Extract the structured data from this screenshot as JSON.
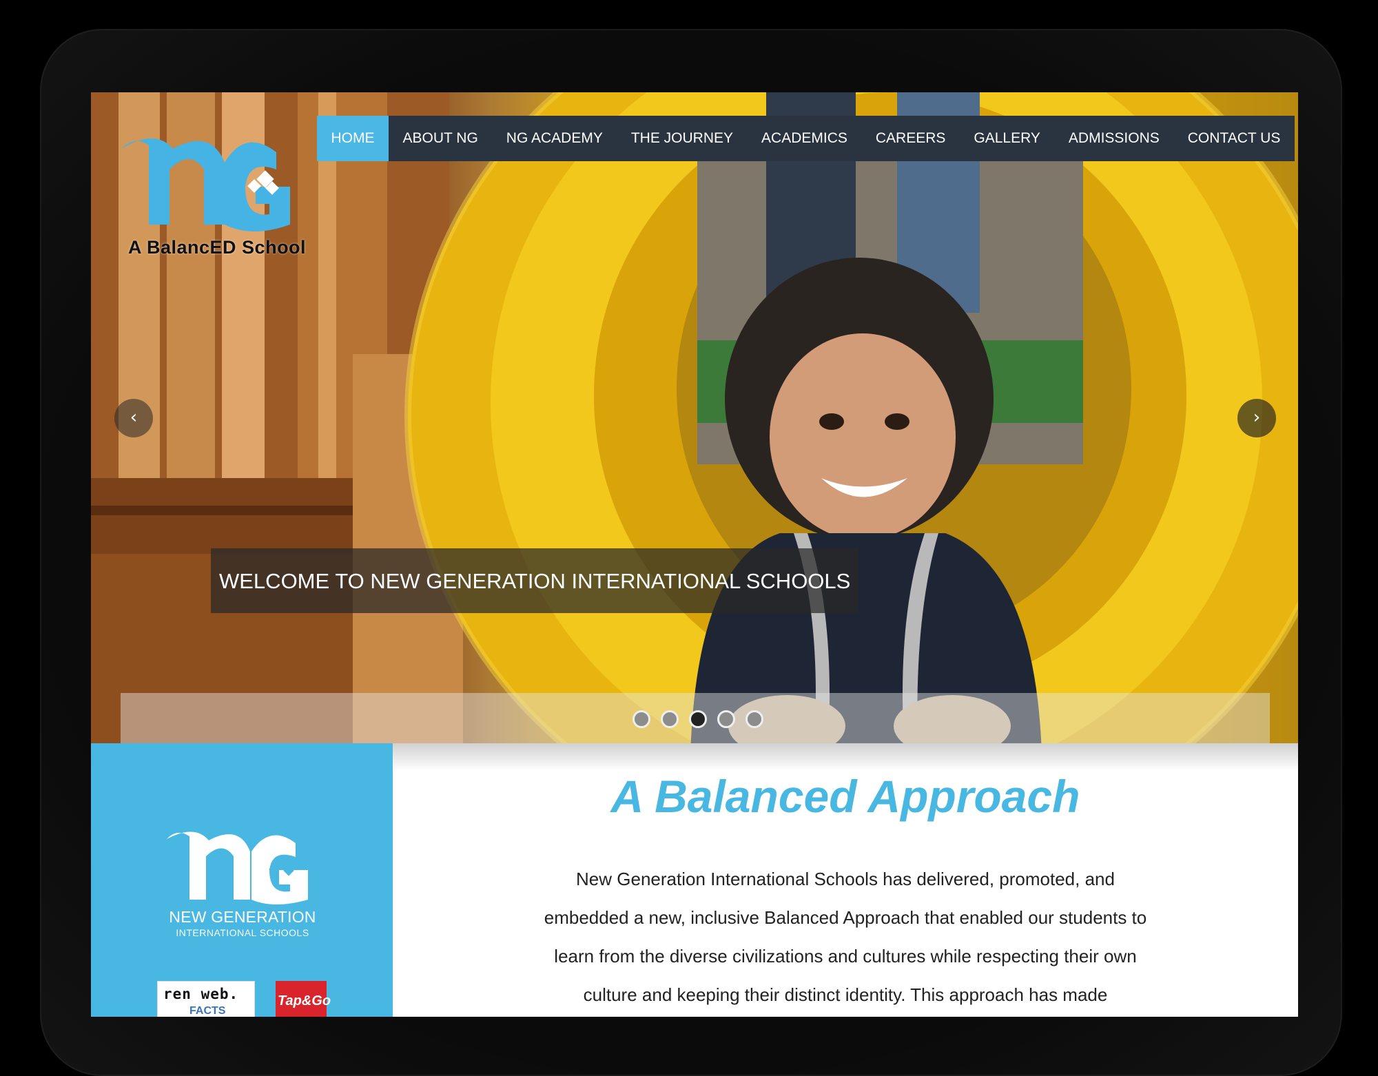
{
  "brand": {
    "logo_letters": "nG",
    "tagline": "A BalancED School"
  },
  "nav": {
    "items": [
      {
        "label": "HOME",
        "active": true
      },
      {
        "label": "ABOUT NG",
        "active": false
      },
      {
        "label": "NG ACADEMY",
        "active": false
      },
      {
        "label": "THE JOURNEY",
        "active": false
      },
      {
        "label": "ACADEMICS",
        "active": false
      },
      {
        "label": "CAREERS",
        "active": false
      },
      {
        "label": "GALLERY",
        "active": false
      },
      {
        "label": "ADMISSIONS",
        "active": false
      },
      {
        "label": "CONTACT US",
        "active": false
      }
    ]
  },
  "slider": {
    "prev_label": "‹",
    "next_label": "›",
    "caption": "WELCOME TO NEW GENERATION INTERNATIONAL SCHOOLS",
    "slide_count": 5,
    "active_slide": 3
  },
  "side_panel": {
    "logo_letters": "nG",
    "school_name_line1": "NEW GENERATION",
    "school_name_line2": "INTERNATIONAL SCHOOLS",
    "badges": [
      {
        "name": "renweb",
        "text": "ren web.",
        "sub": "FACTS"
      },
      {
        "name": "tap-and-go",
        "text": "Tap&Go"
      }
    ]
  },
  "content": {
    "title": "A Balanced Approach",
    "body": "New Generation International Schools has delivered, promoted, and embedded a new, inclusive Balanced Approach that enabled our students to learn from the diverse civilizations and cultures while respecting their own culture and keeping their distinct identity. This approach has made"
  },
  "colors": {
    "accent": "#48b7e2",
    "nav_bg": "#2a3440",
    "device_frame": "#0b0b0b",
    "text": "#222222"
  }
}
